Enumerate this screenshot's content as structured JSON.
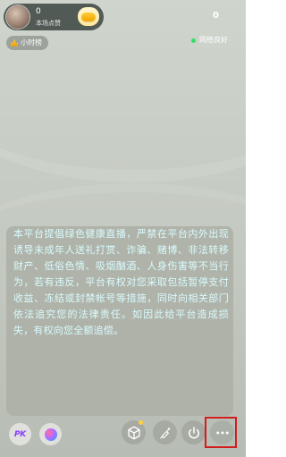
{
  "host": {
    "name": "0",
    "likes_label": "本场点赞"
  },
  "viewers": {
    "count": "0"
  },
  "rank": {
    "label": "小时榜"
  },
  "network": {
    "status": "网络良好"
  },
  "notice": {
    "text": "本平台提倡绿色健康直播，严禁在平台内外出现诱导未成年人送礼打赏、诈骗、赌博、非法转移财产、低俗色情、吸烟酗酒、人身伤害等不当行为，若有违反，平台有权对您采取包括暂停支付收益、冻结或封禁帐号等措施，同时向相关部门依法追究您的法律责任。如因此给平台造成损失，有权向您全额追偿。"
  },
  "toolbar": {
    "pk_label": "PK"
  },
  "icons": {
    "avatar": "avatar-icon",
    "follow": "follow-icon",
    "rank": "crown-icon",
    "network": "dot-icon",
    "pk": "pk-icon",
    "draw": "draw-icon",
    "box": "box-icon",
    "beauty": "beauty-icon",
    "power": "power-icon",
    "more": "more-icon"
  },
  "colors": {
    "highlight": "#d11d1d",
    "network_dot": "#2fe06a",
    "notice_text": "#d9fbff"
  }
}
